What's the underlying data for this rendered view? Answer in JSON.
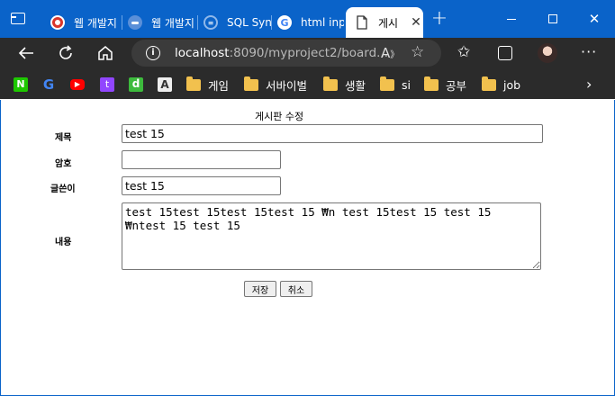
{
  "browser": {
    "tabs": [
      {
        "label": "웹 개발지",
        "favicon_color": "#d9362b"
      },
      {
        "label": "웹 개발지",
        "favicon_color": "#5a8fd8"
      },
      {
        "label": "SQL Synt",
        "favicon_color": "#2f74c7"
      },
      {
        "label": "html inp",
        "favicon_color": "#ffffff"
      },
      {
        "label": "게시",
        "favicon_color": "#ffffff"
      }
    ],
    "url_host": "localhost",
    "url_rest": ":8090/myproject2/board...",
    "bookmarks": [
      {
        "type": "icon",
        "name": "naver-icon",
        "color": "#1ec800",
        "glyph": "N"
      },
      {
        "type": "icon",
        "name": "google-icon",
        "color": "#ffffff",
        "glyph": "G"
      },
      {
        "type": "icon",
        "name": "youtube-icon",
        "color": "#ff0000",
        "glyph": "▶"
      },
      {
        "type": "icon",
        "name": "twitch-icon",
        "color": "#9146ff",
        "glyph": "t"
      },
      {
        "type": "icon",
        "name": "d-icon",
        "color": "#3dbb3d",
        "glyph": "d"
      },
      {
        "type": "icon",
        "name": "a-icon",
        "color": "#eeeeee",
        "glyph": "A"
      }
    ],
    "folders": [
      "게임",
      "서바이벌",
      "생활",
      "si",
      "공부",
      "job"
    ]
  },
  "form": {
    "title": "게시판 수정",
    "subject_label": "제목",
    "subject_value": "test 15",
    "password_label": "암호",
    "password_value": "",
    "writer_label": "글쓴이",
    "writer_value": "test 15",
    "content_label": "내용",
    "content_value": "test 15test 15test 15test 15 ₩n test 15test 15 test 15 ₩ntest 15 test 15",
    "save_label": "저장",
    "cancel_label": "취소"
  }
}
